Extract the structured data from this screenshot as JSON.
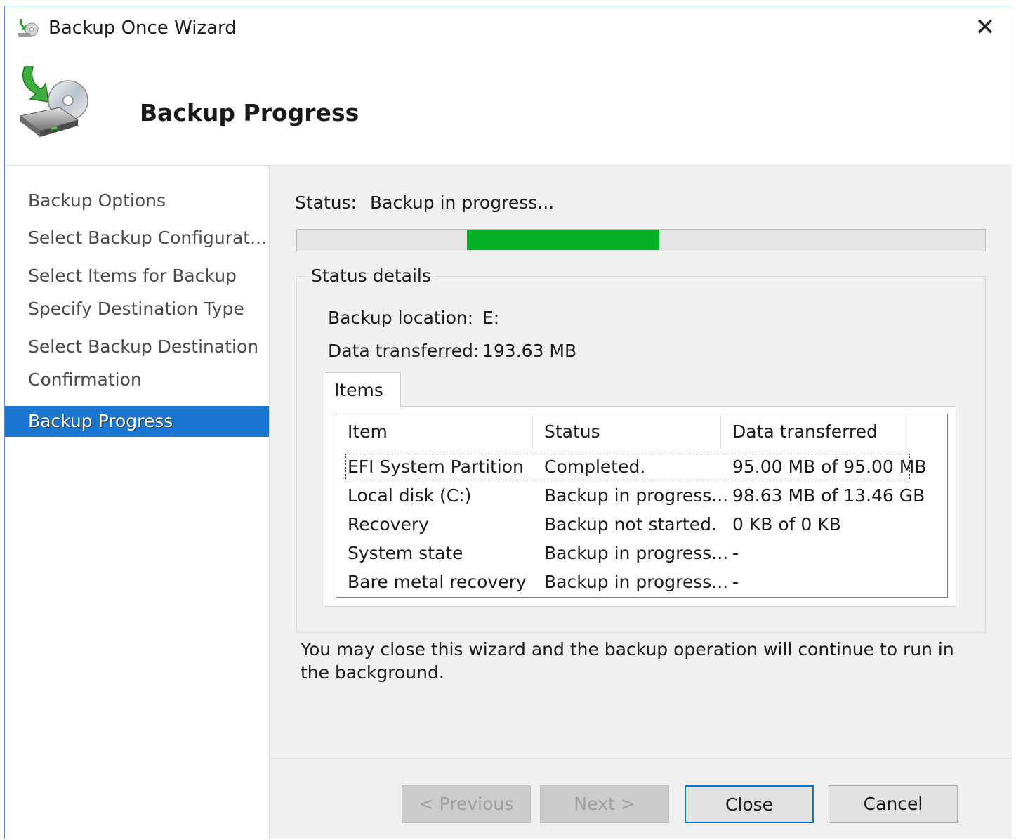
{
  "window": {
    "title": "Backup Once Wizard",
    "close_glyph": "✕"
  },
  "header": {
    "title": "Backup Progress"
  },
  "nav": {
    "items": [
      {
        "label": "Backup Options",
        "active": false
      },
      {
        "label": "Select Backup Configurat...",
        "active": false
      },
      {
        "label": "Select Items for Backup",
        "active": false
      },
      {
        "label": "Specify Destination Type",
        "active": false
      },
      {
        "label": "Select Backup Destination",
        "active": false
      },
      {
        "label": "Confirmation",
        "active": false
      },
      {
        "label": "Backup Progress",
        "active": true
      }
    ]
  },
  "status": {
    "label": "Status:",
    "value": "Backup in progress...",
    "progress_fraction": 0.28,
    "progress_color": "#06b025"
  },
  "details": {
    "legend": "Status details",
    "location_label": "Backup location:",
    "location_value": "E:",
    "transferred_label": "Data transferred:",
    "transferred_value": "193.63 MB"
  },
  "items_tab": {
    "label": "Items",
    "columns": [
      "Item",
      "Status",
      "Data transferred"
    ],
    "rows": [
      {
        "item": "EFI System Partition",
        "status": "Completed.",
        "data": "95.00 MB of 95.00 MB"
      },
      {
        "item": "Local disk (C:)",
        "status": "Backup in progress...",
        "data": "98.63 MB of 13.46 GB"
      },
      {
        "item": "Recovery",
        "status": "Backup not started.",
        "data": "0 KB of 0 KB"
      },
      {
        "item": "System state",
        "status": "Backup in progress...",
        "data": "-"
      },
      {
        "item": "Bare metal recovery",
        "status": "Backup in progress...",
        "data": "-"
      }
    ]
  },
  "note": "You may close this wizard and the backup operation will continue to run in the background.",
  "buttons": {
    "previous": "< Previous",
    "next": "Next >",
    "close": "Close",
    "cancel": "Cancel"
  },
  "colors": {
    "accent": "#1977d2",
    "progress": "#06b025",
    "window_border": "#5a8ad6"
  }
}
